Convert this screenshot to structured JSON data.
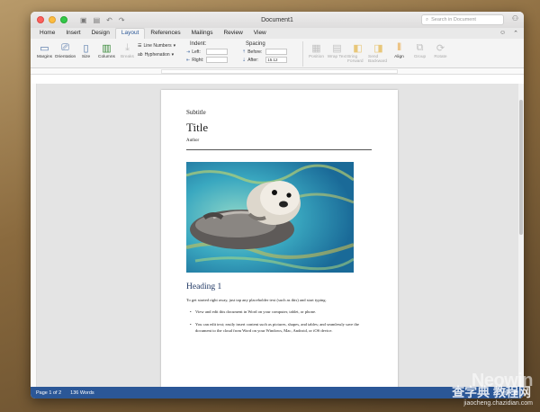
{
  "window": {
    "title": "Document1",
    "search_placeholder": "Search in Document"
  },
  "tabs": [
    {
      "label": "Home"
    },
    {
      "label": "Insert"
    },
    {
      "label": "Design"
    },
    {
      "label": "Layout"
    },
    {
      "label": "References"
    },
    {
      "label": "Mailings"
    },
    {
      "label": "Review"
    },
    {
      "label": "View"
    }
  ],
  "ribbon": {
    "margins": "Margins",
    "orientation": "Orientation",
    "size": "Size",
    "columns": "Columns",
    "breaks": "Breaks",
    "line_numbers": "Line Numbers",
    "hyphenation": "Hyphenation",
    "indent_header": "Indent:",
    "indent_left_label": "Left:",
    "indent_right_label": "Right:",
    "spacing_header": "Spacing",
    "spacing_before_label": "Before:",
    "spacing_after_label": "After:",
    "spacing_after_value": "15.12",
    "position": "Position",
    "wrap_text": "Wrap Text",
    "bring_forward": "Bring Forward",
    "send_backward": "Send Backward",
    "align": "Align",
    "group": "Group",
    "rotate": "Rotate"
  },
  "document": {
    "subtitle": "Subtitle",
    "title": "Title",
    "author": "Author",
    "heading1": "Heading 1",
    "body": "To get started right away, just tap any placeholder text (such as this) and start typing.",
    "bullets": [
      "View and edit this document in Word on your computer, tablet, or phone.",
      "You can edit text; easily insert content such as pictures, shapes, and tables; and seamlessly save the document to the cloud from Word on your Windows, Mac, Android, or iOS device."
    ]
  },
  "status": {
    "page": "Page 1 of 2",
    "words": "136 Words"
  },
  "watermark": {
    "brand": "Neowin",
    "cn": "查字典 教程网",
    "url": "jiaocheng.chazidian.com"
  },
  "colors": {
    "accent": "#2b5797",
    "status_bar": "#2b5797"
  }
}
